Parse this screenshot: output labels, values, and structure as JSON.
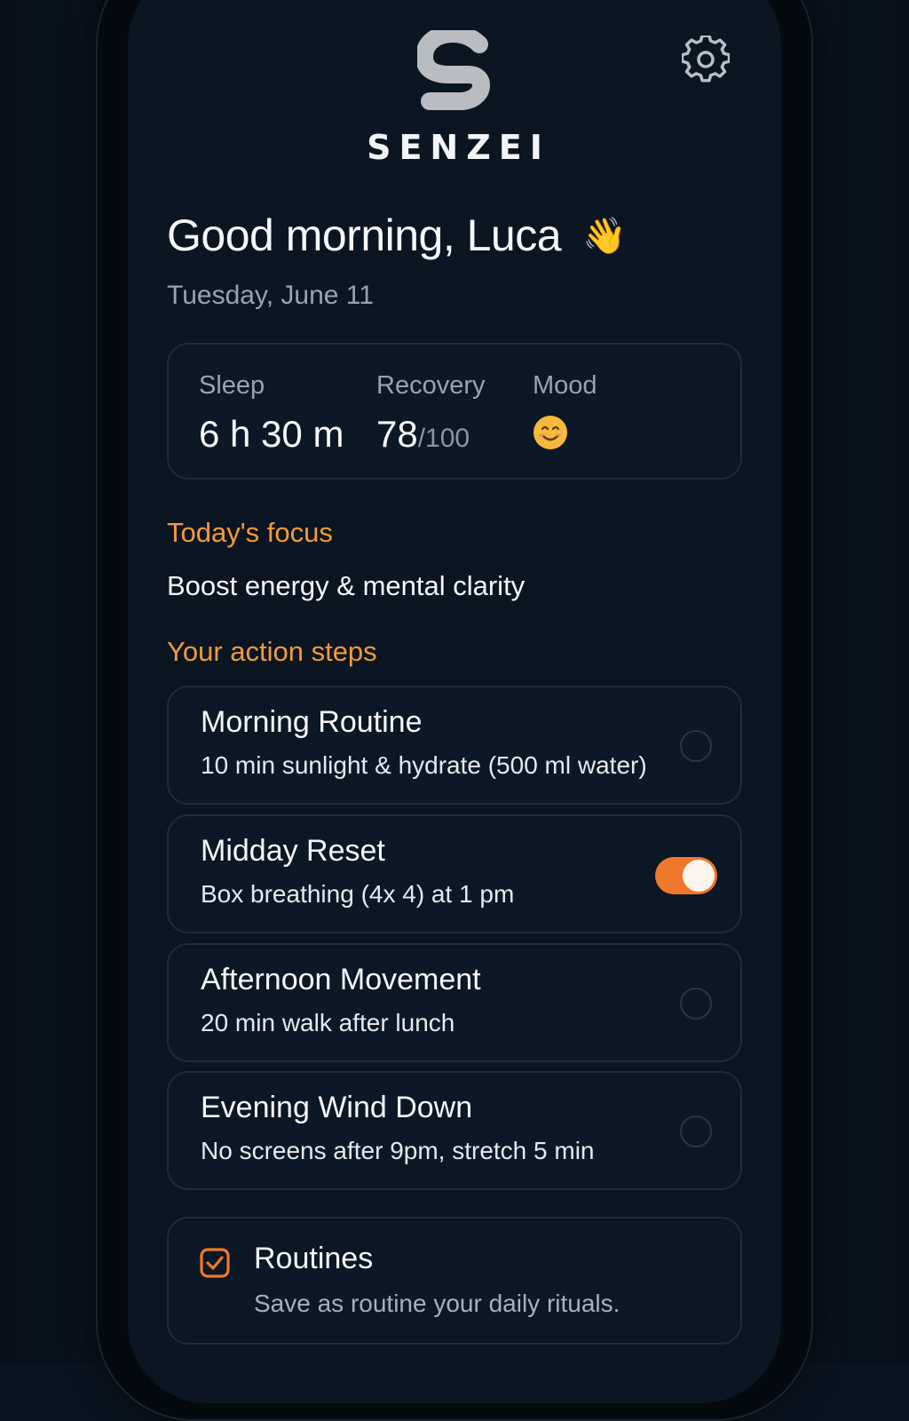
{
  "brand": {
    "name": "SENZEI",
    "accent_color": "#f39a3a",
    "toggle_color": "#f0782c"
  },
  "header": {
    "settings_icon": "gear-icon"
  },
  "greeting": {
    "text": "Good morning, Luca",
    "emoji": "👋",
    "date": "Tuesday, June 11"
  },
  "stats": {
    "sleep": {
      "label": "Sleep",
      "value": "6 h 30 m"
    },
    "recovery": {
      "label": "Recovery",
      "value": "78",
      "unit": "/100"
    },
    "mood": {
      "label": "Mood",
      "icon": "smiling-face-icon"
    }
  },
  "focus": {
    "title": "Today's focus",
    "text": "Boost energy & mental clarity"
  },
  "steps": {
    "title": "Your action steps",
    "items": [
      {
        "title": "Morning Routine",
        "desc": "10 min sunlight & hydrate (500 ml water)",
        "done": false
      },
      {
        "title": "Midday Reset",
        "desc": "Box breathing (4x 4) at 1 pm",
        "done": true
      },
      {
        "title": "Afternoon Movement",
        "desc": "20 min walk after lunch",
        "done": false
      },
      {
        "title": "Evening Wind Down",
        "desc": "No screens after 9pm, stretch 5 min",
        "done": false
      }
    ]
  },
  "routines": {
    "title": "Routines",
    "desc": "Save as routine your daily rituals.",
    "icon": "checkbox-icon"
  }
}
